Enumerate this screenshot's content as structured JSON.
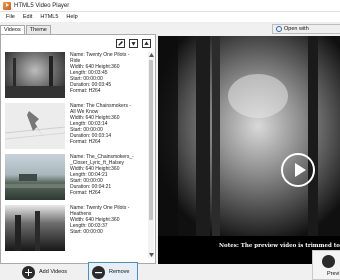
{
  "window": {
    "title": "HTML5 Video Player"
  },
  "menu": [
    "File",
    "Edit",
    "HTML5",
    "Help"
  ],
  "tabs": [
    "Videos",
    "Theme"
  ],
  "toolbar_icons": [
    "edit-icon",
    "download-icon",
    "up-icon"
  ],
  "videos": [
    {
      "name": "Name: Twenty One Pilots -",
      "name2": "Ride",
      "size": "Width: 640  Height:360",
      "length": "Length: 00:03:45",
      "start": "Start: 00:00:00",
      "duration": "Duration: 00:03:45",
      "format": "Format: H264"
    },
    {
      "name": "Name: The Chainsmokers -",
      "name2": "All We Know",
      "size": "Width: 640  Height:360",
      "length": "Length: 00:03:14",
      "start": "Start: 00:00:00",
      "duration": "Duration: 00:03:14",
      "format": "Format: H264"
    },
    {
      "name": "Name: The_Chainsmokers_-",
      "name2": "_Closer_Lyric_ft_Halsey",
      "size": "Width: 640  Height:360",
      "length": "Length: 00:04:21",
      "start": "Start: 00:00:00",
      "duration": "Duration: 00:04:21",
      "format": "Format: H264"
    },
    {
      "name": "Name: Twenty One Pilots -",
      "name2": "Heathens",
      "size": "Width: 640  Height:360",
      "length": "Length: 00:03:37",
      "start": "Start: 00:00:00",
      "duration": "",
      "format": ""
    }
  ],
  "open_web": "Open with",
  "notes": "Notes: The preview video is trimmed to 6 s",
  "buttons": {
    "add": "Add Videos",
    "remove": "Remove",
    "preview": "Previ"
  }
}
